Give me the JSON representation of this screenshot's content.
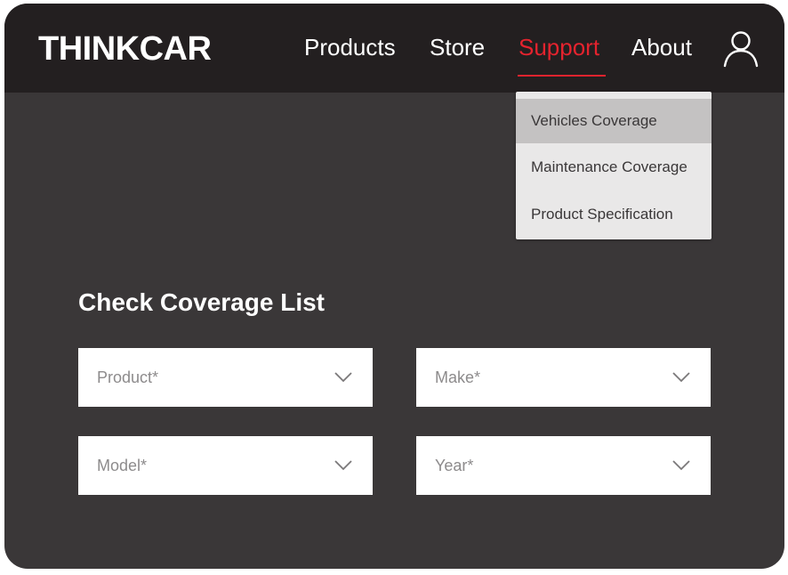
{
  "header": {
    "logo_text": "THINKCAR",
    "nav": [
      {
        "label": "Products"
      },
      {
        "label": "Store"
      },
      {
        "label": "Support",
        "active": true
      },
      {
        "label": "About"
      }
    ],
    "user_icon": "user-account-icon",
    "accent_color": "#e5232e"
  },
  "support_menu": {
    "items": [
      {
        "label": "Vehicles Coverage",
        "highlighted": true
      },
      {
        "label": "Maintenance Coverage"
      },
      {
        "label": "Product Specification"
      }
    ]
  },
  "coverage": {
    "title": "Check Coverage List",
    "selects": [
      {
        "placeholder": "Product*",
        "icon": "chevron-down-icon"
      },
      {
        "placeholder": "Make*",
        "icon": "chevron-down-icon"
      },
      {
        "placeholder": "Model*",
        "icon": "chevron-down-icon"
      },
      {
        "placeholder": "Year*",
        "icon": "chevron-down-icon"
      }
    ]
  }
}
